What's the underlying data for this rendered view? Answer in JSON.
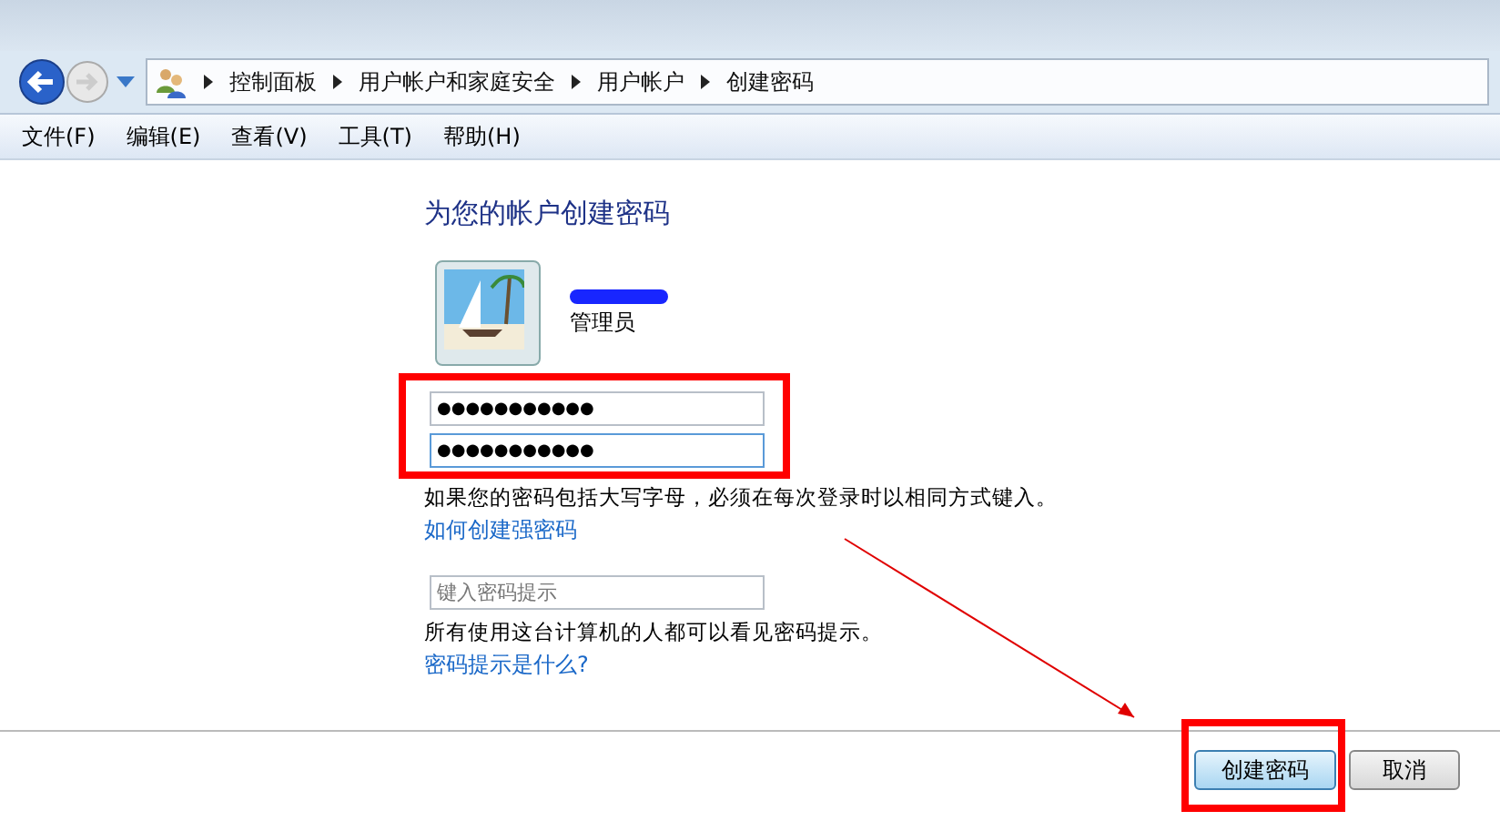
{
  "address_bar": {
    "breadcrumbs": [
      "控制面板",
      "用户帐户和家庭安全",
      "用户帐户",
      "创建密码"
    ]
  },
  "menu_bar": [
    "文件(F)",
    "编辑(E)",
    "查看(V)",
    "工具(T)",
    "帮助(H)"
  ],
  "content": {
    "title": "为您的帐户创建密码",
    "account": {
      "role": "管理员",
      "name_redacted": true
    },
    "password_fields": [
      {
        "value": "●●●●●●●●●●●",
        "focused": false
      },
      {
        "value": "●●●●●●●●●●●",
        "focused": true
      }
    ],
    "case_note": "如果您的密码包括大写字母，必须在每次登录时以相同方式键入。",
    "strong_password_link": "如何创建强密码",
    "hint_field": {
      "placeholder": "键入密码提示"
    },
    "hint_note": "所有使用这台计算机的人都可以看见密码提示。",
    "hint_link": "密码提示是什么?"
  },
  "buttons": [
    {
      "label": "创建密码",
      "kind": "primary"
    },
    {
      "label": "取消",
      "kind": "secondary"
    }
  ],
  "annotations": {
    "highlight_fields": true,
    "highlight_button": true,
    "arrow": true
  }
}
